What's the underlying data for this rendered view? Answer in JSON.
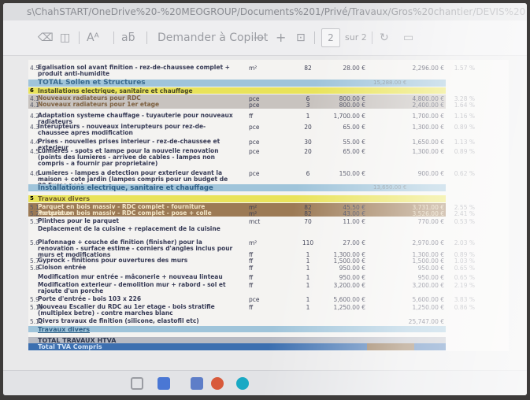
{
  "address": {
    "path": "s\\ChahSTART/OneDrive%20-%20MEOGROUP/Documents%201/Privé/Travaux/Gros%20chantier/DEVIS%20"
  },
  "toolbar": {
    "aa_label": "Aᴬ",
    "read_label": "aƃ",
    "copilot_label": "Demander à Copilot",
    "minus_label": "—",
    "plus_label": "+",
    "page_value": "2",
    "page_of": "sur 2"
  },
  "table": {
    "rows": [
      {
        "no": "4.5",
        "desc": "Egalisation sol avant finition - rez-de-chaussee complet + produit anti-humidite",
        "unit": "m²",
        "qty": "82",
        "price": "28.00 €",
        "total": "2,296.00 €",
        "pct": "1.57 %"
      },
      {
        "no": "6",
        "desc": "Installations electrique, sanitaire et chauffage",
        "unit": "",
        "qty": "",
        "price": "",
        "total": "",
        "pct": ""
      },
      {
        "no": "4.1",
        "desc": "Nouveaux radiateurs pour RDC",
        "unit": "pce",
        "qty": "6",
        "price": "800.00 €",
        "total": "4,800.00 €",
        "pct": "3.28 %"
      },
      {
        "no": "4.1",
        "desc": "Nouveaux radiateurs pour 1er etage",
        "unit": "pce",
        "qty": "3",
        "price": "800.00 €",
        "total": "2,400.00 €",
        "pct": "1.64 %"
      },
      {
        "no": "4.2",
        "desc": "Adaptation systeme chauffage - tuyauterie pour nouveaux radiateurs",
        "unit": "ff",
        "qty": "1",
        "price": "1,700.00 €",
        "total": "1,700.00 €",
        "pct": "1.16 %"
      },
      {
        "no": "4.3",
        "desc": "Interupteurs - nouveaux interupteurs pour rez-de-chaussee apres modification",
        "unit": "pce",
        "qty": "20",
        "price": "65.00 €",
        "total": "1,300.00 €",
        "pct": "0.89 %"
      },
      {
        "no": "4.4",
        "desc": "Prises - nouvelles prises interieur - rez-de-chaussee et exterieur",
        "unit": "pce",
        "qty": "30",
        "price": "55.00 €",
        "total": "1,650.00 €",
        "pct": "1.13 %"
      },
      {
        "no": "4.5",
        "desc": "Lumieres - spots et lampe pour la nouvelle renovation (points des lumieres - arrivee de cables - lampes non compris - a fournir par proprietaire)",
        "unit": "pce",
        "qty": "20",
        "price": "65.00 €",
        "total": "1,300.00 €",
        "pct": "0.89 %"
      },
      {
        "no": "4.6",
        "desc": "Lumieres - lampes a detection pour exterieur devant la maison + cote jardin (lampes compris pour un budget de 90 Euros pce)",
        "unit": "pce",
        "qty": "6",
        "price": "150.00 €",
        "total": "900.00 €",
        "pct": "0.62 %"
      },
      {
        "no": "5",
        "desc": "Travaux divers",
        "unit": "",
        "qty": "",
        "price": "",
        "total": "",
        "pct": ""
      },
      {
        "no": "5.1",
        "desc": "Parquet en bois massiv - RDC complet - fourniture materiaux",
        "unit": "m²",
        "qty": "82",
        "price": "45.50 €",
        "total": "3,731.00 €",
        "pct": "2.55 %"
      },
      {
        "no": "5.2",
        "desc": "Parquet en bois massiv - RDC complet - pose + colle",
        "unit": "m²",
        "qty": "82",
        "price": "43.00 €",
        "total": "3,526.00 €",
        "pct": "2.41 %"
      },
      {
        "no": "5.3",
        "desc": "Plinthes pour le parquet",
        "unit": "mct",
        "qty": "70",
        "price": "11.00 €",
        "total": "770.00 €",
        "pct": "0.53 %"
      },
      {
        "no": "",
        "desc": "Deplacement de la cuisine + replacement de la cuisine",
        "unit": "",
        "qty": "",
        "price": "",
        "total": "",
        "pct": ""
      },
      {
        "no": "5.6",
        "desc": "Plafonnage + couche de finition (finisher) pour la renovation - surface estime - corniers d'angles inclus pour murs et modifications",
        "unit": "m²",
        "qty": "110",
        "price": "27.00 €",
        "total": "2,970.00 €",
        "pct": "2.03 %"
      },
      {
        "no": "",
        "desc": "",
        "unit": "ff",
        "qty": "1",
        "price": "1,300.00 €",
        "total": "1,300.00 €",
        "pct": "0.89 %"
      },
      {
        "no": "5.7",
        "desc": "Gyprock - finitions pour ouvertures des murs",
        "unit": "ff",
        "qty": "1",
        "price": "1,500.00 €",
        "total": "1,500.00 €",
        "pct": "1.03 %"
      },
      {
        "no": "5.8",
        "desc": "Cloison entrée",
        "unit": "ff",
        "qty": "1",
        "price": "950.00 €",
        "total": "950.00 €",
        "pct": "0.65 %"
      },
      {
        "no": "",
        "desc": "Modification mur entrée - mâconerie + nouveau linteau",
        "unit": "ff",
        "qty": "1",
        "price": "950.00 €",
        "total": "950.00 €",
        "pct": "0.65 %"
      },
      {
        "no": "",
        "desc": "Modification exterieur - demolition mur + rabord - sol et rajoute d'un porche",
        "unit": "ff",
        "qty": "1",
        "price": "3,200.00 €",
        "total": "3,200.00 €",
        "pct": "2.19 %"
      },
      {
        "no": "5.9",
        "desc": "Porte d'entrée - bois 103 x 226",
        "unit": "pce",
        "qty": "1",
        "price": "5,600.00 €",
        "total": "5,600.00 €",
        "pct": "3.83 %"
      },
      {
        "no": "5.10",
        "desc": "Nouveau Escalier du RDC au 1er etage - bois stratifie (multiplex betre) - contre marches blanc",
        "unit": "ff",
        "qty": "1",
        "price": "1,250.00 €",
        "total": "1,250.00 €",
        "pct": "0.86 %"
      },
      {
        "no": "5.11",
        "desc": "Divers travaux de finition (silicone, elastofil etc)",
        "unit": "",
        "qty": "",
        "price": "",
        "total": "25,747.00 €",
        "pct": ""
      }
    ],
    "bands": {
      "total_sols": "TOTAL Sollen et Structures",
      "install_section": "Installations electrique, sanitaire et chauffage",
      "install_total": "Installations electrique, sanitaire et chauffage",
      "travaux_total": "Travaux divers",
      "grand_total": "TOTAL TRAVAUX HTVA",
      "tva": "Total TVA Compris"
    },
    "band_totals": {
      "total_sols": "15,288.00 €",
      "install_total": "13,650.00 €"
    }
  },
  "colors": {
    "yellow": "#e9e35a",
    "blue": "#3c6fb0",
    "gray": "#b9b4b0",
    "tan": "#8a6a47"
  }
}
